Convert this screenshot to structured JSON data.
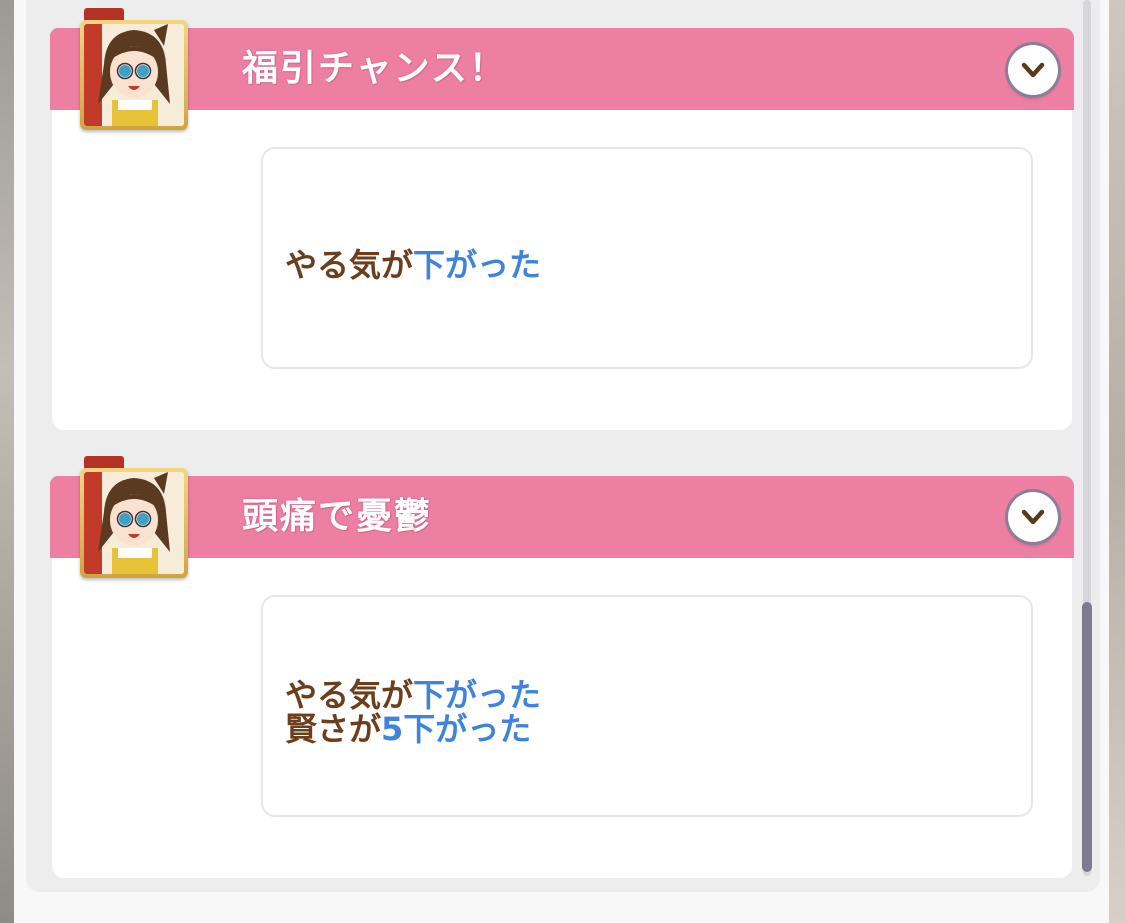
{
  "events": [
    {
      "title": "福引チャンス！",
      "effects": [
        {
          "text": "やる気が",
          "highlight": "下がった"
        }
      ]
    },
    {
      "title": "頭痛で憂鬱",
      "effects": [
        {
          "text": "やる気が",
          "highlight": "下がった"
        },
        {
          "text": "賢さが",
          "highlight": "5下がった"
        }
      ]
    }
  ],
  "colors": {
    "header_pink": "#ed7fa2",
    "effect_text": "#6d3e1b",
    "effect_highlight": "#3f84da",
    "scroll_thumb": "#7d7a91"
  },
  "icons": {
    "expand": "chevron-down-icon",
    "avatar": "character-portrait"
  }
}
